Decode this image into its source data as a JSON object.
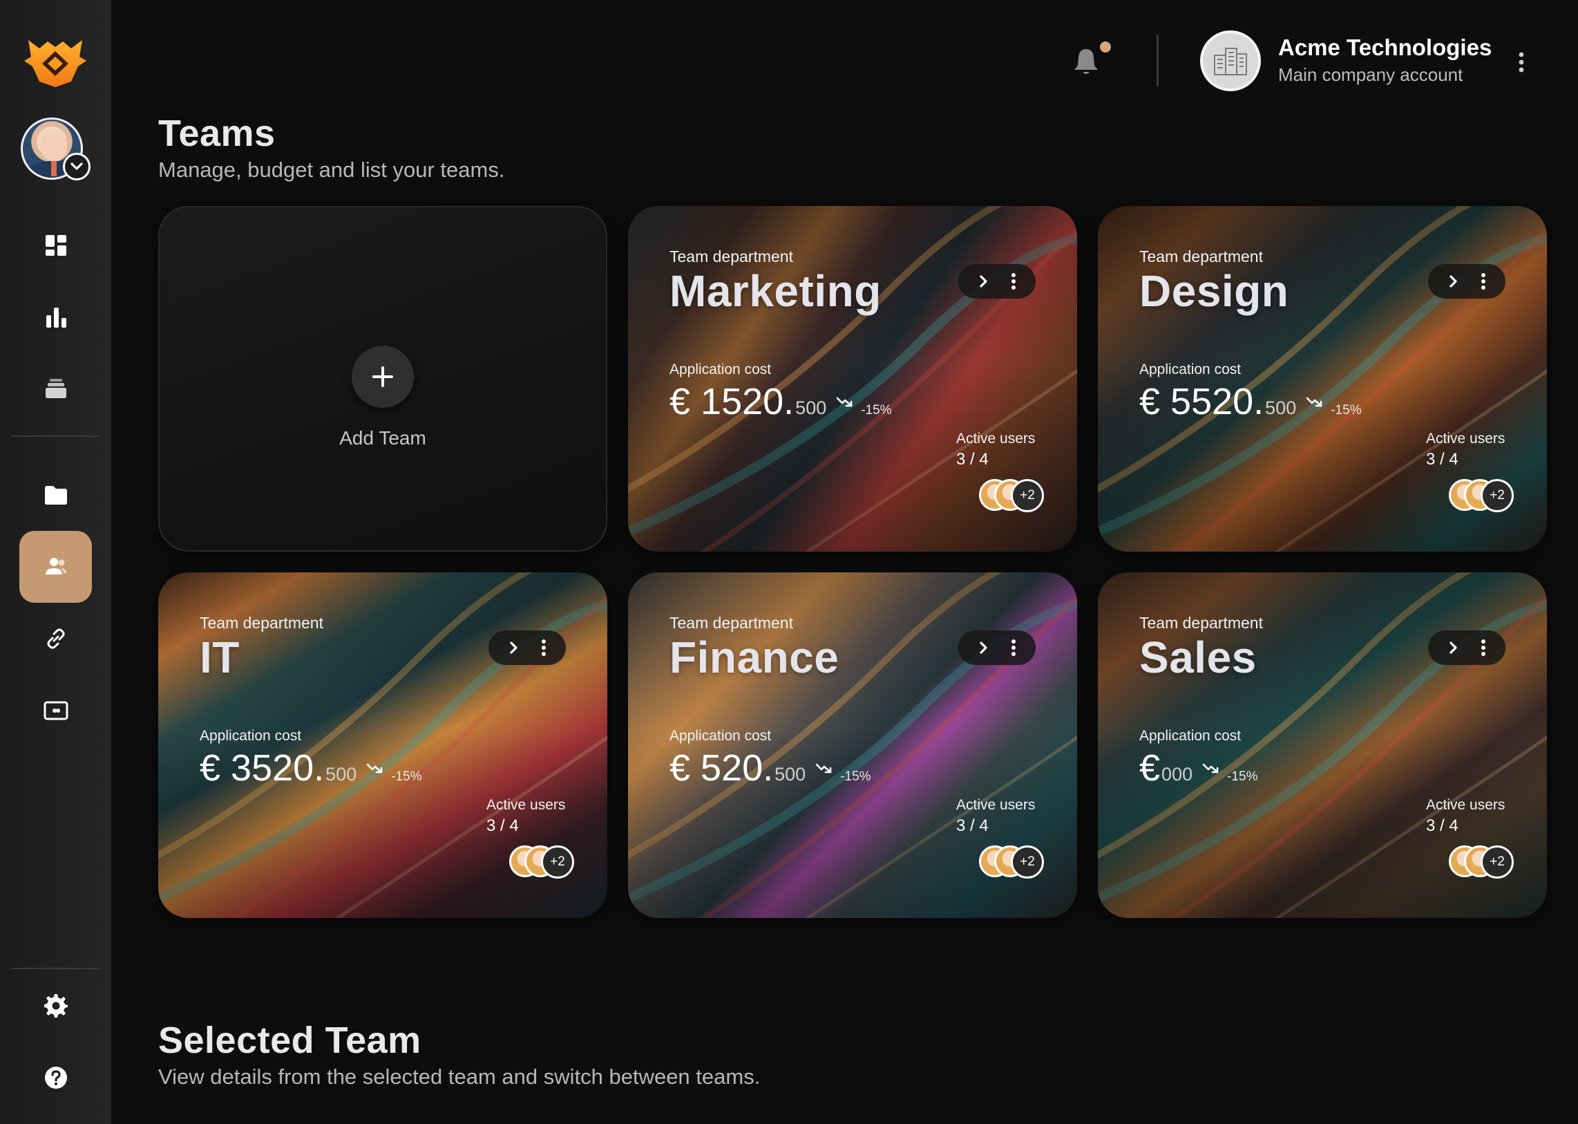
{
  "header": {
    "company_name": "Acme Technologies",
    "company_subtitle": "Main company account",
    "notification_dot_color": "#d6a57a"
  },
  "sidebar": {
    "items": [
      {
        "name": "dashboard",
        "icon": "dashboard-icon"
      },
      {
        "name": "analytics",
        "icon": "bar-chart-icon"
      },
      {
        "name": "stack",
        "icon": "layers-icon"
      },
      {
        "name": "files",
        "icon": "folder-icon"
      },
      {
        "name": "teams",
        "icon": "users-icon",
        "active": true
      },
      {
        "name": "links",
        "icon": "link-icon"
      },
      {
        "name": "billing",
        "icon": "card-icon"
      },
      {
        "name": "settings",
        "icon": "gear-icon"
      },
      {
        "name": "help",
        "icon": "help-icon"
      }
    ],
    "active_color": "#c59a72"
  },
  "teams_section": {
    "title": "Teams",
    "subtitle": "Manage, budget and list your teams.",
    "add_label": "Add Team"
  },
  "teams": [
    {
      "dept_label": "Team department",
      "name": "Marketing",
      "cost_label": "Application cost",
      "cost_main": "€ 1520.",
      "cost_decimal": "500",
      "trend": "-15%",
      "users_label": "Active users",
      "users_value": "3 / 4",
      "extra_users": "+2"
    },
    {
      "dept_label": "Team department",
      "name": "Design",
      "cost_label": "Application cost",
      "cost_main": "€ 5520.",
      "cost_decimal": "500",
      "trend": "-15%",
      "users_label": "Active users",
      "users_value": "3 / 4",
      "extra_users": "+2"
    },
    {
      "dept_label": "Team department",
      "name": "IT",
      "cost_label": "Application cost",
      "cost_main": "€ 3520.",
      "cost_decimal": "500",
      "trend": "-15%",
      "users_label": "Active users",
      "users_value": "3 / 4",
      "extra_users": "+2"
    },
    {
      "dept_label": "Team department",
      "name": "Finance",
      "cost_label": "Application cost",
      "cost_main": "€ 520.",
      "cost_decimal": "500",
      "trend": "-15%",
      "users_label": "Active users",
      "users_value": "3 / 4",
      "extra_users": "+2"
    },
    {
      "dept_label": "Team department",
      "name": "Sales",
      "cost_label": "Application cost",
      "cost_main": "€ ",
      "cost_decimal": "000",
      "trend": "-15%",
      "users_label": "Active users",
      "users_value": "3 / 4",
      "extra_users": "+2"
    }
  ],
  "selected_section": {
    "title": "Selected Team",
    "subtitle": "View details from the selected team and switch between teams."
  }
}
